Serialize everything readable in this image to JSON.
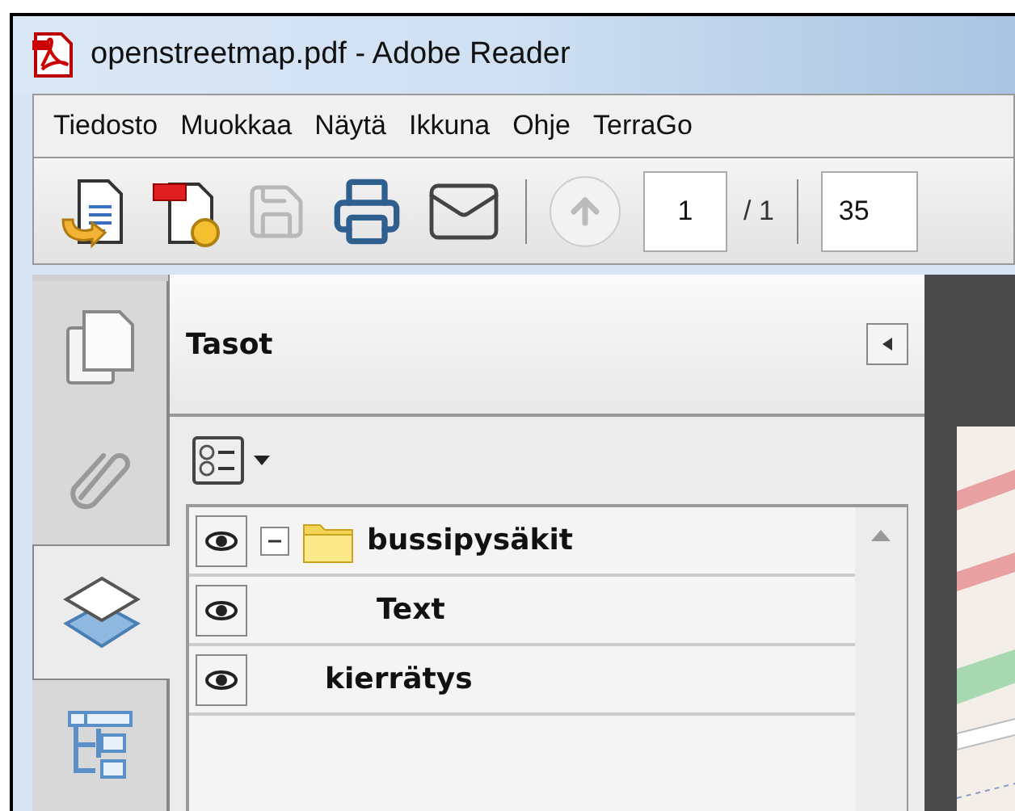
{
  "window": {
    "title": "openstreetmap.pdf - Adobe Reader"
  },
  "menu": [
    "Tiedosto",
    "Muokkaa",
    "Näytä",
    "Ikkuna",
    "Ohje",
    "TerraGo"
  ],
  "toolbar": {
    "page": "1",
    "page_total": "/ 1",
    "zoom": "35"
  },
  "sidebar_tabs": [
    {
      "kind": "pages",
      "selected": false
    },
    {
      "kind": "attachments",
      "selected": false
    },
    {
      "kind": "layers",
      "selected": true
    },
    {
      "kind": "tree",
      "selected": false
    }
  ],
  "panel": {
    "title": "Tasot"
  },
  "layers": [
    {
      "name": "bussipysäkit",
      "visible": true,
      "expanded": true,
      "children": [
        {
          "name": "Text",
          "visible": true
        }
      ]
    },
    {
      "name": "kierrätys",
      "visible": true
    }
  ]
}
